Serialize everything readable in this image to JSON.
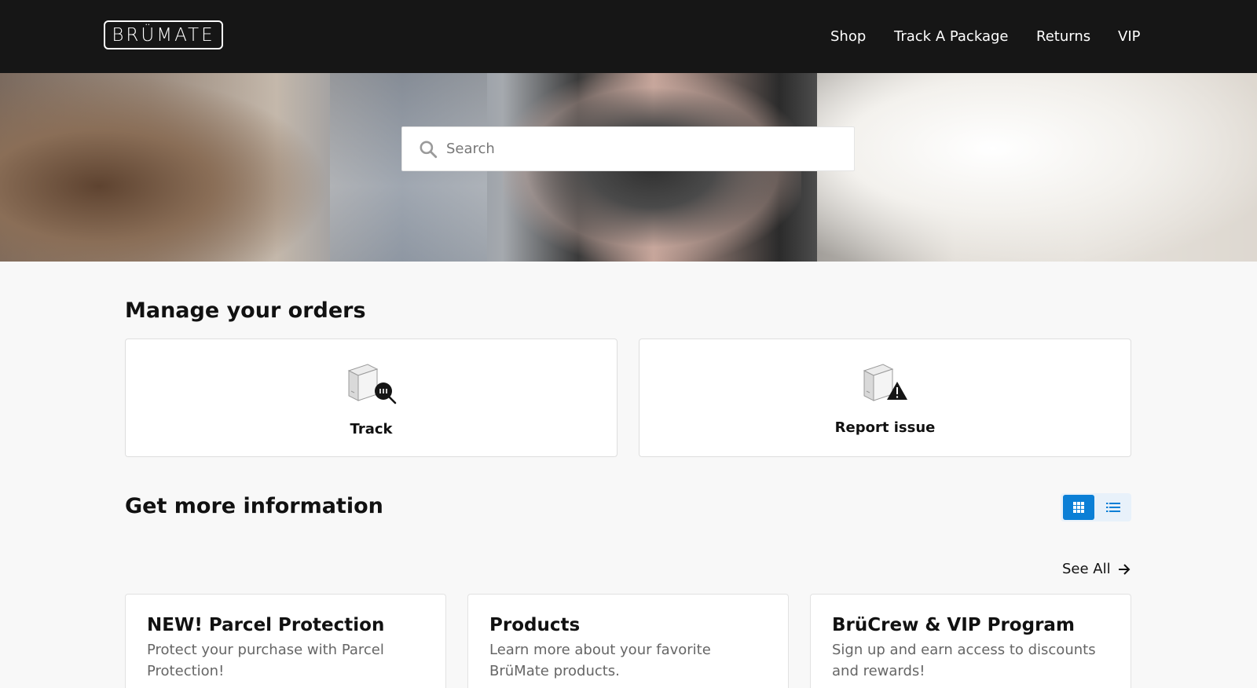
{
  "header": {
    "logo_text": "BRÜMATE",
    "nav": [
      {
        "label": "Shop"
      },
      {
        "label": "Track A Package"
      },
      {
        "label": "Returns"
      },
      {
        "label": "VIP"
      }
    ]
  },
  "search": {
    "placeholder": "Search",
    "icon": "search-icon"
  },
  "orders": {
    "title": "Manage your orders",
    "cards": [
      {
        "label": "Track",
        "icon": "package-search-icon"
      },
      {
        "label": "Report issue",
        "icon": "package-warning-icon"
      }
    ]
  },
  "info": {
    "title": "Get more information",
    "view_toggle": {
      "selected": "grid",
      "options": [
        "grid-view-icon",
        "list-view-icon"
      ]
    },
    "see_all_label": "See All",
    "cards": [
      {
        "title": "NEW! Parcel Protection",
        "description": "Protect your purchase with Parcel Protection!"
      },
      {
        "title": "Products",
        "description": "Learn more about your favorite BrüMate products."
      },
      {
        "title": "BrüCrew & VIP Program",
        "description": "Sign up and earn access to discounts and rewards!"
      }
    ]
  },
  "colors": {
    "header_bg": "#161616",
    "accent": "#0b7fd6",
    "page_bg": "#f8f8f8"
  }
}
